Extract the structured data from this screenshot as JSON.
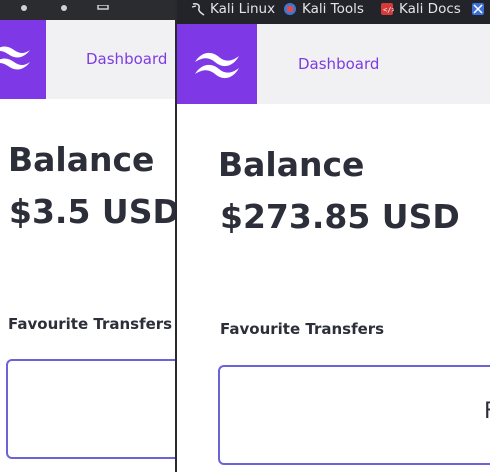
{
  "bookmarks": [
    {
      "label": "Kali Linux",
      "icon": "kali-dragon-icon"
    },
    {
      "label": "Kali Tools",
      "icon": "kali-tools-icon"
    },
    {
      "label": "Kali Docs",
      "icon": "kali-docs-icon"
    },
    {
      "label": "",
      "icon": "kali-forums-icon"
    }
  ],
  "back_window": {
    "nav": {
      "link_label": "Dashboard"
    },
    "balance": {
      "title": "Balance",
      "amount": "$3.5 USD"
    },
    "favourites": {
      "title": "Favourite Transfers"
    }
  },
  "front_window": {
    "nav": {
      "link_label": "Dashboard"
    },
    "balance": {
      "title": "Balance",
      "amount": "$273.85 USD"
    },
    "favourites": {
      "title": "Favourite Transfers",
      "card_partial_text": "F"
    }
  },
  "colors": {
    "brand": "#7e38e6",
    "link": "#7d3ce0",
    "card_border": "#6b63d8",
    "text": "#2c2f39"
  }
}
